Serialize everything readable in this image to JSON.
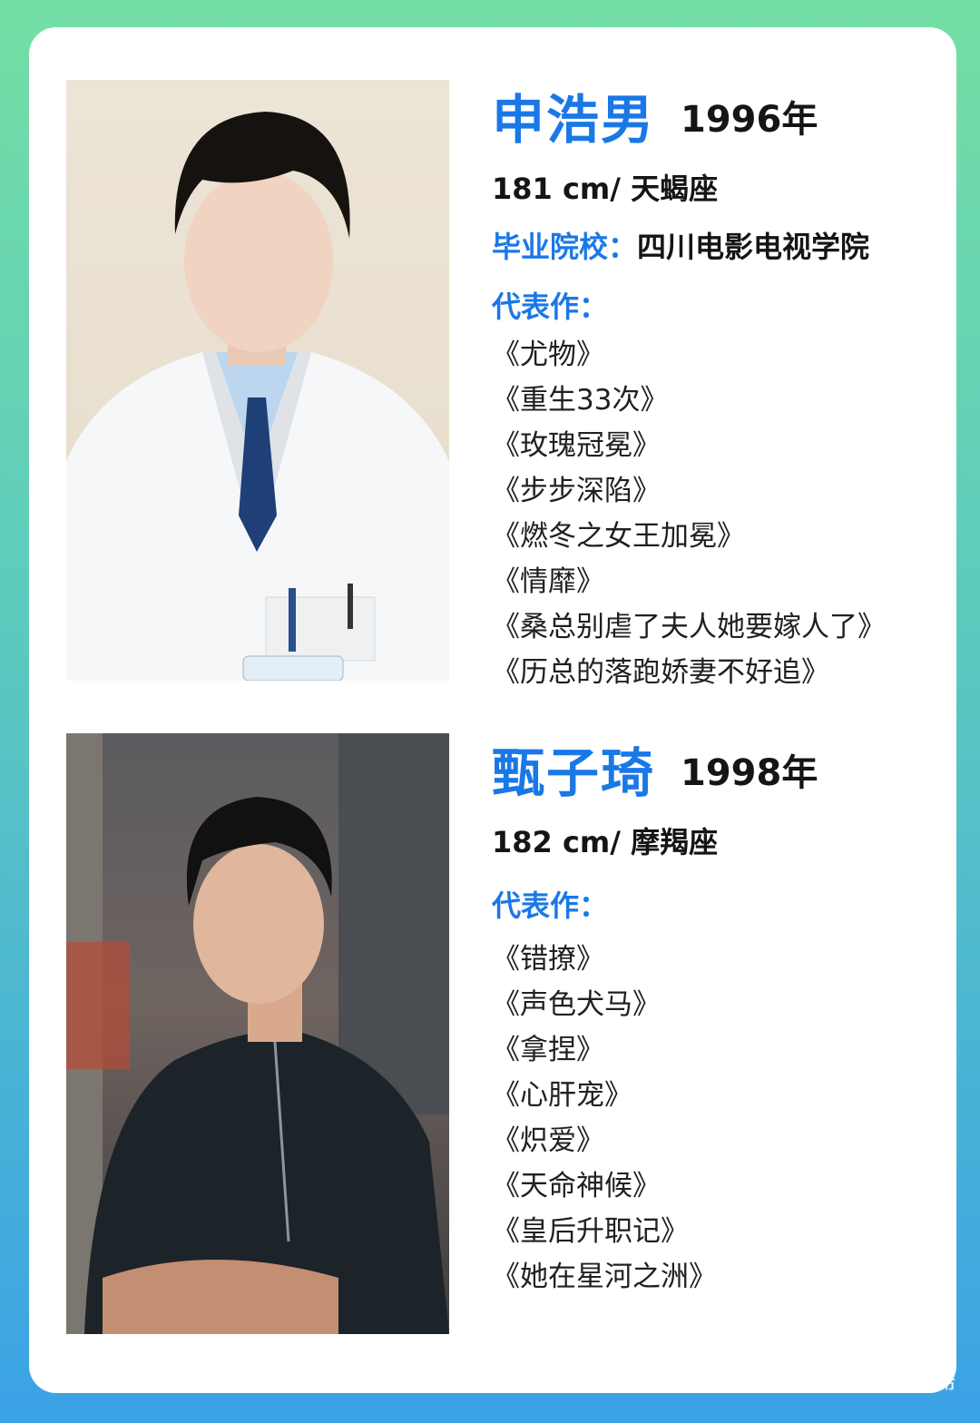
{
  "profiles": [
    {
      "name": "申浩男",
      "year": "1996年",
      "stats": "181 cm/ 天蝎座",
      "school_label": "毕业院校：",
      "school": "四川电影电视学院",
      "works_label": "代表作：",
      "works": [
        "《尤物》",
        "《重生33次》",
        "《玫瑰冠冕》",
        "《步步深陷》",
        "《燃冬之女王加冕》",
        "《情靡》",
        "《桑总别虐了夫人她要嫁人了》",
        "《历总的落跑娇妻不好追》"
      ]
    },
    {
      "name": "甄子琦",
      "year": "1998年",
      "stats": "182 cm/ 摩羯座",
      "works_label": "代表作：",
      "works": [
        "《错撩》",
        "《声色犬马》",
        "《拿捏》",
        "《心肝宠》",
        "《炽爱》",
        "《天命神候》",
        "《皇后升职记》",
        "《她在星河之洲》"
      ]
    }
  ],
  "watermark": "知乎 @剧供需",
  "colors": {
    "accent": "#1a78e6",
    "text": "#151515"
  }
}
